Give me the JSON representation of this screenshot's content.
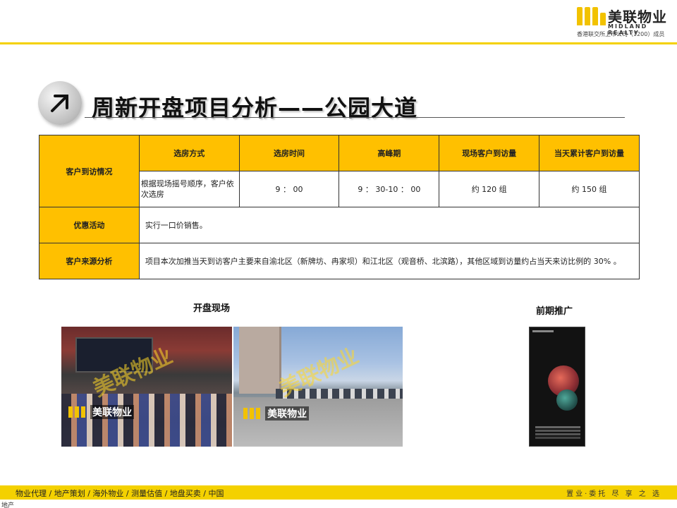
{
  "header": {
    "logo_cn": "美联物业",
    "logo_en": "MIDLAND REALTY",
    "logo_sub": "香港联交所上市公司（1200）成员",
    "brand_color": "#f4d100"
  },
  "title": {
    "text": "周新开盘项目分析——公园大道",
    "icon": "arrow-up-left-icon"
  },
  "table": {
    "row1_label": "客户到访情况",
    "columns": [
      "选房方式",
      "选房时间",
      "高峰期",
      "现场客户到访量",
      "当天累计客户到访量"
    ],
    "values": [
      "根据现场摇号顺序，客户依次选房",
      "9 ： 00",
      "9 ： 30-10 ： 00",
      "约 120 组",
      "约 150 组"
    ],
    "row2_label": "优惠活动",
    "row2_value": "实行一口价销售。",
    "row3_label": "客户来源分析",
    "row3_value": "项目本次加推当天到访客户主要来自渝北区（新牌坊、冉家坝）和江北区（观音桥、北滨路），其他区域到访量约占当天来访比例的 30% 。"
  },
  "sections": {
    "opening_label": "开盘现场",
    "promo_label": "前期推广"
  },
  "watermark": {
    "text": "美联物业"
  },
  "footer": {
    "nav": "物业代理 / 地产策划 / 海外物业 / 测量估值 / 地盘买卖 / 中国",
    "slogan": "置业·委托 尽 享 之 选"
  },
  "corner": "地产"
}
